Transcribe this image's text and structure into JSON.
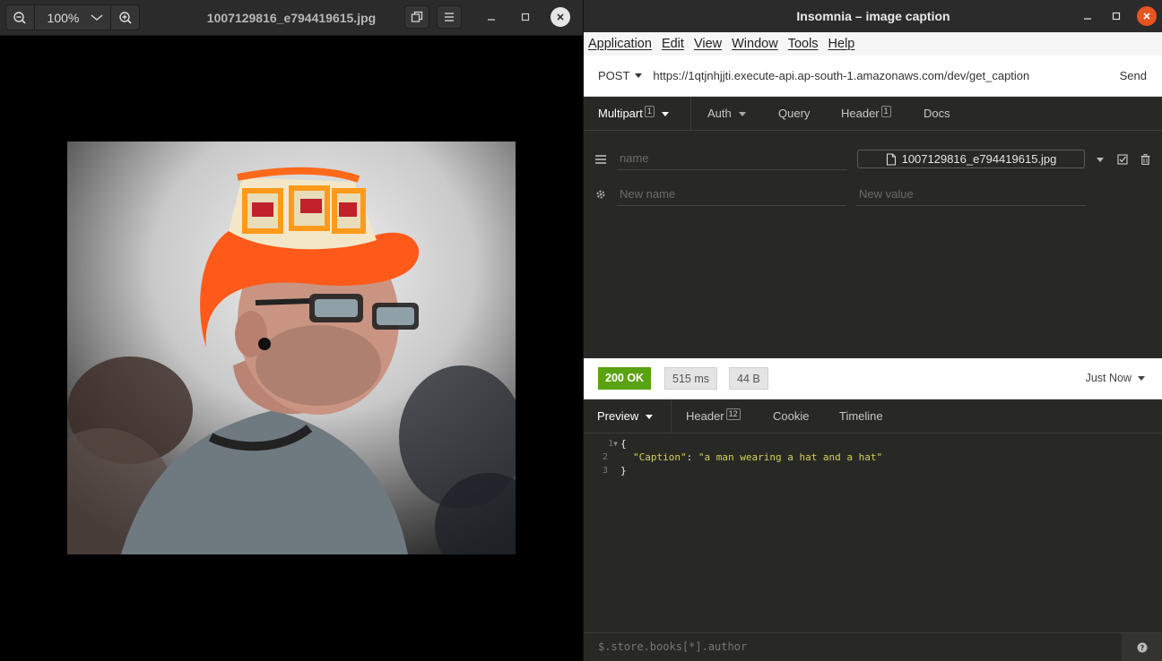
{
  "viewer": {
    "zoom": "100%",
    "filename": "1007129816_e794419615.jpg"
  },
  "insomnia": {
    "window_title": "Insomnia – image caption",
    "menu": [
      "Application",
      "Edit",
      "View",
      "Window",
      "Tools",
      "Help"
    ],
    "method": "POST",
    "url": "https://1qtjnhjjti.execute-api.ap-south-1.amazonaws.com/dev/get_caption",
    "send_label": "Send",
    "request_tabs": {
      "multipart": "Multipart",
      "multipart_count": "1",
      "auth": "Auth",
      "query": "Query",
      "header": "Header",
      "header_count": "1",
      "docs": "Docs"
    },
    "form": {
      "name_placeholder": "name",
      "file_name": "1007129816_e794419615.jpg",
      "new_name_placeholder": "New name",
      "new_value_placeholder": "New value"
    },
    "status": {
      "code": "200 OK",
      "time": "515 ms",
      "size": "44 B",
      "when": "Just Now"
    },
    "response_tabs": {
      "preview": "Preview",
      "header": "Header",
      "header_count": "12",
      "cookie": "Cookie",
      "timeline": "Timeline"
    },
    "response": {
      "lines": [
        "1",
        "2",
        "3"
      ],
      "open_brace": "{",
      "key": "\"Caption\"",
      "colon": ": ",
      "value": "\"a man wearing a hat and a hat\"",
      "close_brace": "}"
    },
    "filter_placeholder": "$.store.books[*].author"
  },
  "colors": {
    "status_ok": "#59a210",
    "close_button": "#e95420",
    "panel_bg": "#282925",
    "json_string": "#d2cf5a"
  }
}
